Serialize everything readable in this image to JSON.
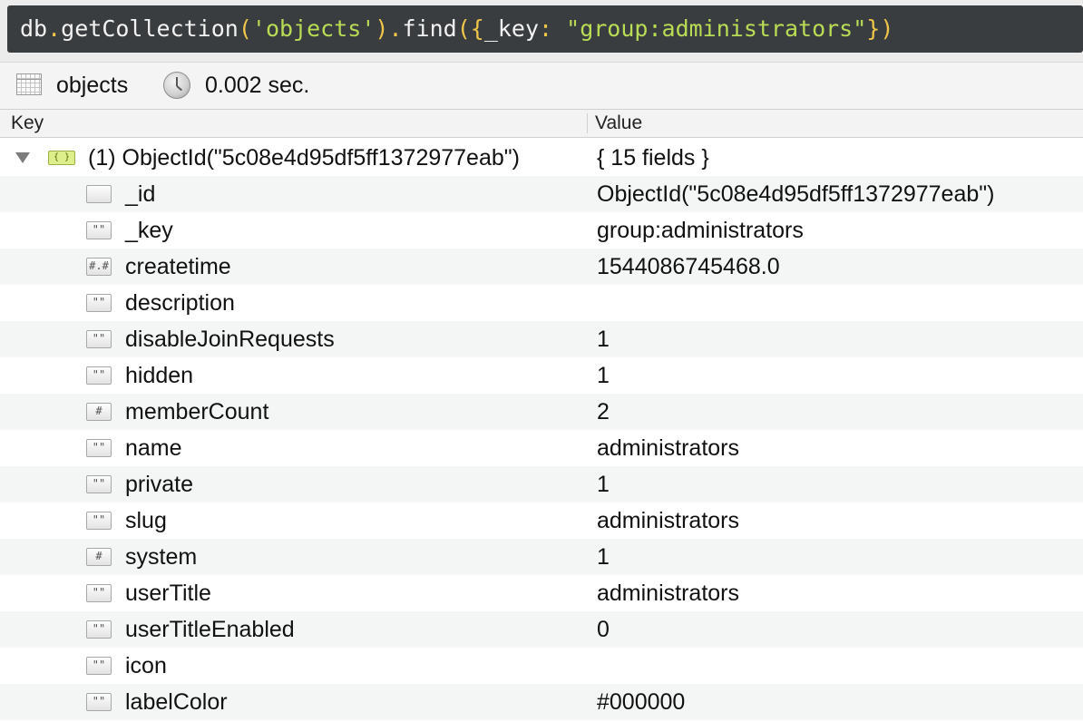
{
  "query": {
    "db": "db",
    "dot1": ".",
    "method1": "getCollection",
    "paren1_open": "(",
    "collection_literal": "'objects'",
    "paren1_close": ")",
    "dot2": ".",
    "method2": "find",
    "paren2_open": "({",
    "filter_key": "_key",
    "colon": ": ",
    "filter_value": "\"group:administrators\"",
    "paren2_close": "})"
  },
  "info": {
    "collection": "objects",
    "time": "0.002 sec.",
    "table_icon": "table-grid-icon",
    "clock_icon": "clock-icon"
  },
  "columns": {
    "key": "Key",
    "value": "Value"
  },
  "root": {
    "key": "(1) ObjectId(\"5c08e4d95df5ff1372977eab\")",
    "value": "{ 15 fields }",
    "icon_glyph": "{ }"
  },
  "fields": [
    {
      "key": "_id",
      "value": "ObjectId(\"5c08e4d95df5ff1372977eab\")",
      "icon": "objectid-type-icon",
      "glyph": ""
    },
    {
      "key": "_key",
      "value": "group:administrators",
      "icon": "string-type-icon",
      "glyph": "\"\""
    },
    {
      "key": "createtime",
      "value": "1544086745468.0",
      "icon": "double-type-icon",
      "glyph": "#.#"
    },
    {
      "key": "description",
      "value": "",
      "icon": "string-type-icon",
      "glyph": "\"\""
    },
    {
      "key": "disableJoinRequests",
      "value": "1",
      "icon": "string-type-icon",
      "glyph": "\"\""
    },
    {
      "key": "hidden",
      "value": "1",
      "icon": "string-type-icon",
      "glyph": "\"\""
    },
    {
      "key": "memberCount",
      "value": "2",
      "icon": "int-type-icon",
      "glyph": "#"
    },
    {
      "key": "name",
      "value": "administrators",
      "icon": "string-type-icon",
      "glyph": "\"\""
    },
    {
      "key": "private",
      "value": "1",
      "icon": "string-type-icon",
      "glyph": "\"\""
    },
    {
      "key": "slug",
      "value": "administrators",
      "icon": "string-type-icon",
      "glyph": "\"\""
    },
    {
      "key": "system",
      "value": "1",
      "icon": "int-type-icon",
      "glyph": "#"
    },
    {
      "key": "userTitle",
      "value": "administrators",
      "icon": "string-type-icon",
      "glyph": "\"\""
    },
    {
      "key": "userTitleEnabled",
      "value": "0",
      "icon": "string-type-icon",
      "glyph": "\"\""
    },
    {
      "key": "icon",
      "value": "",
      "icon": "string-type-icon",
      "glyph": "\"\""
    },
    {
      "key": "labelColor",
      "value": "#000000",
      "icon": "string-type-icon",
      "glyph": "\"\""
    }
  ],
  "colors": {
    "query_bg": "#3a3d3f",
    "query_punct": "#f0c64a",
    "query_string": "#b9dc55",
    "row_alt": "#f4f5f5"
  }
}
